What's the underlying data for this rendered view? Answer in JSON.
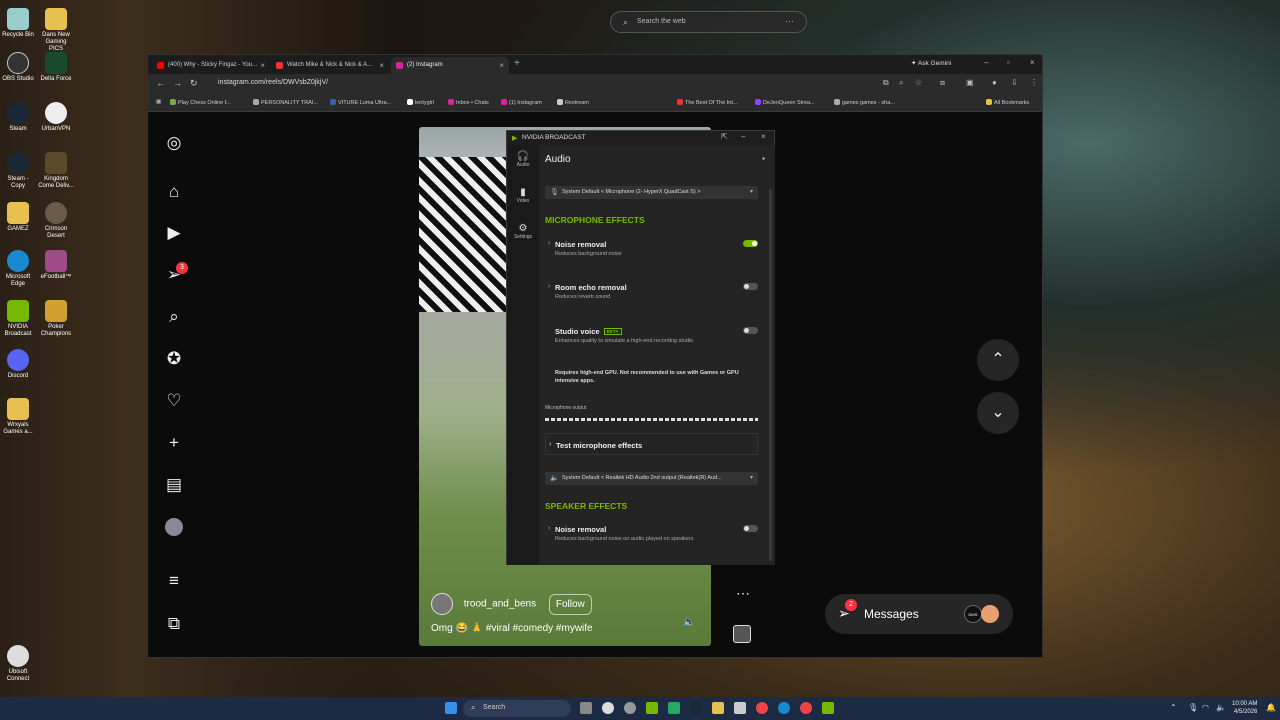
{
  "desktop": {
    "icons": [
      {
        "label": "Recycle Bin"
      },
      {
        "label": "Dans New Gaming PICS"
      },
      {
        "label": "OBS Studio"
      },
      {
        "label": "Delta Force"
      },
      {
        "label": "Steam"
      },
      {
        "label": "UrbanVPN"
      },
      {
        "label": "Steam - Copy"
      },
      {
        "label": "Kingdom Come Deliv..."
      },
      {
        "label": "GAMEZ"
      },
      {
        "label": "Crimson Desert"
      },
      {
        "label": "Microsoft Edge"
      },
      {
        "label": "eFootball™"
      },
      {
        "label": "NVIDIA Broadcast"
      },
      {
        "label": "Poker Champions"
      },
      {
        "label": "Discord"
      },
      {
        "label": "Wrxyals Games a..."
      },
      {
        "label": "Ubisoft Connect"
      }
    ],
    "search_placeholder": "Search the web"
  },
  "browser": {
    "tabs": [
      {
        "title": "(400) Why - Sticky Fingaz - You..."
      },
      {
        "title": "Watch Mike & Nick & Nick & A..."
      },
      {
        "title": "(2) Instagram"
      }
    ],
    "ask_gemini": "Ask Gemini",
    "url": "instagram.com/reels/DWVsbZ0jkjV/",
    "bookmarks": [
      "Play Chess Online f...",
      "PERSONALITY TRAI...",
      "VITURE Luma Ultra...",
      "lentyglrl",
      "Inbox • Chats",
      "(1) Instagram",
      "Restream",
      "The Best Of The Int...",
      "DeJenQueen Strea...",
      "games games - sha...",
      "All Bookmarks"
    ]
  },
  "instagram": {
    "notif_badge": "3",
    "reel": {
      "username": "trood_and_bens",
      "follow": "Follow",
      "caption": "Omg 😂 🙏 #viral #comedy #mywife"
    },
    "messages": {
      "label": "Messages",
      "badge": "2",
      "avatar1": "DMS"
    }
  },
  "nvidia": {
    "title": "NVIDIA BROADCAST",
    "nav": [
      {
        "label": "Audio"
      },
      {
        "label": "Video"
      },
      {
        "label": "Settings"
      }
    ],
    "header": "Audio",
    "mic_device": "System Default < Microphone (2- HyperX QuadCast S) >",
    "mic_section": "MICROPHONE EFFECTS",
    "mic_effects": [
      {
        "name": "Noise removal",
        "desc": "Reduces background noise",
        "on": true
      },
      {
        "name": "Room echo removal",
        "desc": "Reduces reverb sound",
        "on": false
      },
      {
        "name": "Studio voice",
        "desc": "Enhances quality to simulate a high-end recording studio",
        "on": false,
        "badge": "BETA"
      }
    ],
    "studio_warning": "Requires high-end GPU. Not recommended to use with Games or GPU intensive apps.",
    "mic_output": "Microphone output",
    "test_effects": "Test microphone effects",
    "speaker_device": "System Default < Realtek HD Audio 2nd output (Realtek(R) Aud...",
    "speaker_section": "SPEAKER EFFECTS",
    "speaker_effects": [
      {
        "name": "Noise removal",
        "desc": "Reduces background noise on audio played on speakers",
        "on": false
      }
    ]
  },
  "taskbar": {
    "search": "Search",
    "time": "10:00 AM",
    "date": "4/5/2026"
  }
}
